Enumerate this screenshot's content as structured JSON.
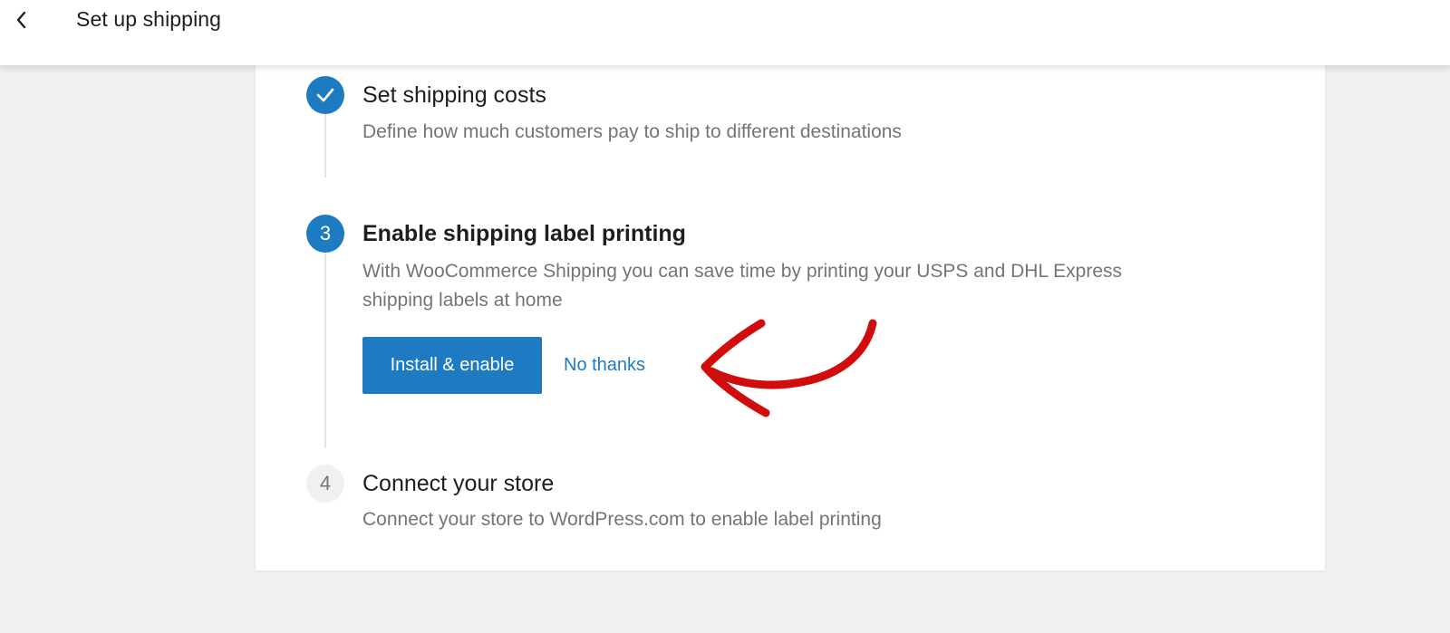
{
  "header": {
    "title": "Set up shipping",
    "back_icon": "chevron-left-icon"
  },
  "steps": [
    {
      "status": "done",
      "icon": "check-icon",
      "title": "Set shipping costs",
      "description": "Define how much customers pay to ship to different destinations"
    },
    {
      "status": "active",
      "number": "3",
      "title": "Enable shipping label printing",
      "description_line1": "With WooCommerce Shipping you can save time by printing your USPS and DHL Express",
      "description_line2": "shipping labels at home",
      "primary_button": "Install & enable",
      "secondary_link": "No thanks"
    },
    {
      "status": "pending",
      "number": "4",
      "title": "Connect your store",
      "description": "Connect your store to WordPress.com to enable label printing"
    }
  ],
  "colors": {
    "accent": "#1f7bc1",
    "annotation_arrow": "#d10c0c",
    "background": "#f0f0f1",
    "card": "#ffffff"
  }
}
